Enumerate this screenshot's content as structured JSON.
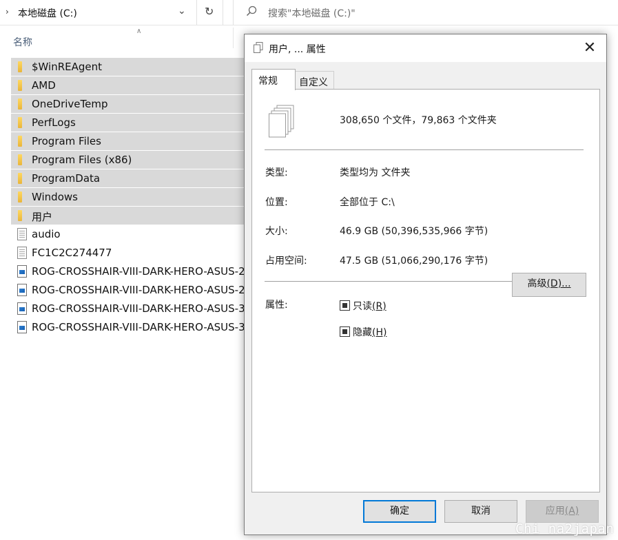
{
  "address_bar": {
    "path": "本地磁盘 (C:)",
    "search_placeholder": "搜索\"本地磁盘 (C:)\""
  },
  "file_list": {
    "column_name": "名称",
    "items": [
      {
        "name": "$WinREAgent",
        "type": "folder",
        "selected": true
      },
      {
        "name": "AMD",
        "type": "folder",
        "selected": true
      },
      {
        "name": "OneDriveTemp",
        "type": "folder",
        "selected": true
      },
      {
        "name": "PerfLogs",
        "type": "folder",
        "selected": true
      },
      {
        "name": "Program Files",
        "type": "folder",
        "selected": true
      },
      {
        "name": "Program Files (x86)",
        "type": "folder",
        "selected": true
      },
      {
        "name": "ProgramData",
        "type": "folder",
        "selected": true
      },
      {
        "name": "Windows",
        "type": "folder",
        "selected": true
      },
      {
        "name": "用户",
        "type": "folder",
        "selected": true
      },
      {
        "name": "audio",
        "type": "file",
        "selected": false
      },
      {
        "name": "FC1C2C274477",
        "type": "file",
        "selected": false
      },
      {
        "name": "ROG-CROSSHAIR-VIII-DARK-HERO-ASUS-2",
        "type": "image",
        "selected": false
      },
      {
        "name": "ROG-CROSSHAIR-VIII-DARK-HERO-ASUS-2",
        "type": "image",
        "selected": false
      },
      {
        "name": "ROG-CROSSHAIR-VIII-DARK-HERO-ASUS-3",
        "type": "image",
        "selected": false
      },
      {
        "name": "ROG-CROSSHAIR-VIII-DARK-HERO-ASUS-3",
        "type": "image",
        "selected": false
      }
    ]
  },
  "dialog": {
    "title": "用户, ... 属性",
    "tabs": [
      "常规",
      "自定义"
    ],
    "count_text": "308,650 个文件，79,863 个文件夹",
    "props": {
      "type_label": "类型:",
      "type_value": "类型均为 文件夹",
      "location_label": "位置:",
      "location_value": "全部位于 C:\\",
      "size_label": "大小:",
      "size_value": "46.9 GB (50,396,535,966 字节)",
      "disk_label": "占用空间:",
      "disk_value": "47.5 GB (51,066,290,176 字节)"
    },
    "attributes_label": "属性:",
    "readonly_text": "只读",
    "readonly_key": "(R)",
    "hidden_text": "隐藏",
    "hidden_key": "(H)",
    "advanced_text": "高级",
    "advanced_key": "(D)...",
    "ok": "确定",
    "cancel": "取消",
    "apply_text": "应用",
    "apply_key": "(A)"
  },
  "watermark": "Chi na2japan",
  "icons": [
    "chevron-right-icon",
    "chevron-down-icon",
    "refresh-icon",
    "search-icon",
    "folder-icon",
    "file-icon",
    "image-file-icon",
    "multi-file-icon",
    "close-icon"
  ]
}
